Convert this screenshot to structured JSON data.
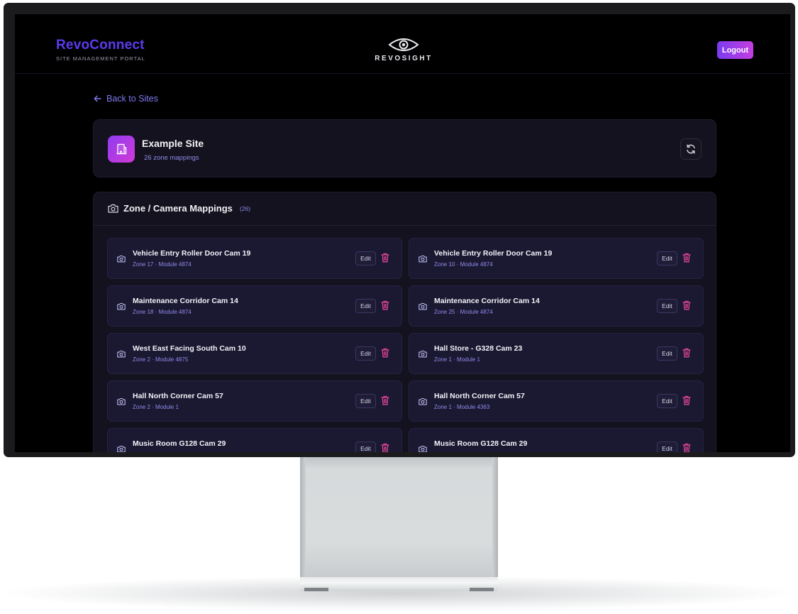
{
  "header": {
    "brand_title": "RevoConnect",
    "brand_subtitle": "SITE MANAGEMENT PORTAL",
    "logo_text": "REVOSIGHT",
    "logout_label": "Logout"
  },
  "nav": {
    "back_label": "Back to Sites"
  },
  "site": {
    "name": "Example Site",
    "mapping_count_text": "26 zone mappings"
  },
  "mappings": {
    "title": "Zone / Camera Mappings",
    "count_badge": "(26)",
    "edit_label": "Edit",
    "items": [
      {
        "name": "Vehicle Entry Roller Door Cam 19",
        "detail": "Zone 17 · Module 4874"
      },
      {
        "name": "Vehicle Entry Roller Door Cam 19",
        "detail": "Zone 10 · Module 4874"
      },
      {
        "name": "Maintenance Corridor Cam 14",
        "detail": "Zone 18 · Module 4874"
      },
      {
        "name": "Maintenance Corridor Cam 14",
        "detail": "Zone 25 · Module 4874"
      },
      {
        "name": "West East Facing South Cam 10",
        "detail": "Zone 2 · Module 4875"
      },
      {
        "name": "Hall Store - G328 Cam 23",
        "detail": "Zone 1 · Module 1"
      },
      {
        "name": "Hall North Corner Cam 57",
        "detail": "Zone 2 · Module 1"
      },
      {
        "name": "Hall North Corner Cam 57",
        "detail": "Zone 1 · Module 4363"
      },
      {
        "name": "Music Room G128 Cam 29",
        "detail": ""
      },
      {
        "name": "Music Room G128 Cam 29",
        "detail": ""
      }
    ]
  },
  "colors": {
    "brand": "#5b3bef",
    "accent_gradient_start": "#7b3cf0",
    "accent_gradient_end": "#c33ee0",
    "delete_icon": "#e0459a",
    "subtext": "#8f8ae8"
  },
  "icons": {
    "back": "arrow-left-icon",
    "site": "building-icon",
    "refresh": "refresh-icon",
    "mapping": "camera-icon",
    "delete": "trash-icon",
    "logo": "eye-icon"
  }
}
